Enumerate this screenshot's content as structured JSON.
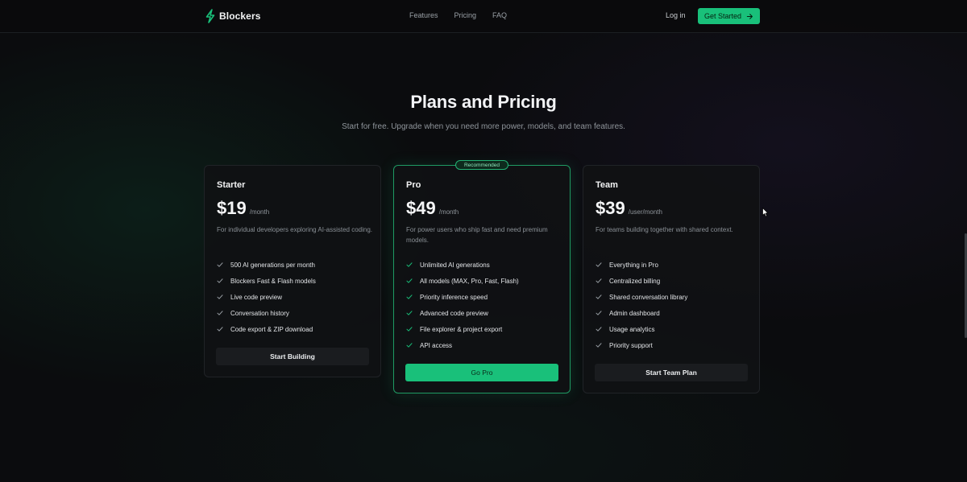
{
  "header": {
    "brand": "Blockers",
    "nav": [
      "Features",
      "Pricing",
      "FAQ"
    ],
    "login": "Log in",
    "cta": "Get Started"
  },
  "hero": {
    "title": "Plans and Pricing",
    "subtitle": "Start for free. Upgrade when you need more power, models, and team features."
  },
  "plans": [
    {
      "name": "Starter",
      "price": "$19",
      "period": "/month",
      "description": "For individual developers exploring AI-assisted coding.",
      "features": [
        "500 AI generations per month",
        "Blockers Fast & Flash models",
        "Live code preview",
        "Conversation history",
        "Code export & ZIP download"
      ],
      "button": "Start Building"
    },
    {
      "name": "Pro",
      "badge": "Recommended",
      "price": "$49",
      "period": "/month",
      "description": "For power users who ship fast and need premium models.",
      "features": [
        "Unlimited AI generations",
        "All models (MAX, Pro, Fast, Flash)",
        "Priority inference speed",
        "Advanced code preview",
        "File explorer & project export",
        "API access"
      ],
      "button": "Go Pro"
    },
    {
      "name": "Team",
      "price": "$39",
      "period": "/user/month",
      "description": "For teams building together with shared context.",
      "features": [
        "Everything in Pro",
        "Centralized billing",
        "Shared conversation library",
        "Admin dashboard",
        "Usage analytics",
        "Priority support"
      ],
      "button": "Start Team Plan"
    }
  ],
  "colors": {
    "accent": "#19c07a",
    "background": "#0b0c0e",
    "card": "#101113"
  },
  "icons": {
    "brand": "lightning-bolt-icon",
    "cta": "arrow-right-icon",
    "feature": "check-icon"
  }
}
